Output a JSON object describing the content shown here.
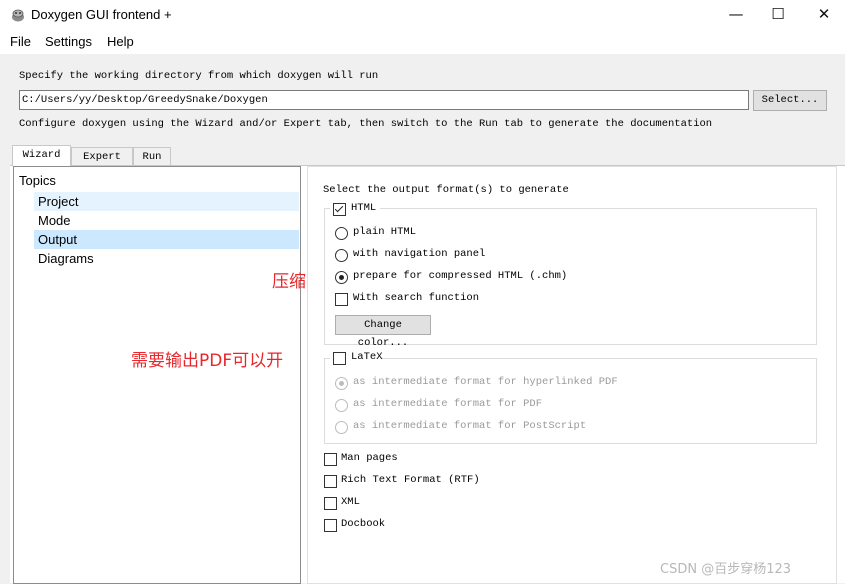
{
  "window": {
    "title": "Doxygen GUI frontend +",
    "minimize_glyph": "—",
    "maximize_glyph": "☐",
    "close_glyph": "✕"
  },
  "menu": [
    "File",
    "Settings",
    "Help"
  ],
  "workdir": {
    "label": "Specify the working directory from which doxygen will run",
    "path": "C:/Users/yy/Desktop/GreedySnake/Doxygen",
    "select_button": "Select..."
  },
  "instructions": "Configure doxygen using the Wizard and/or Expert tab, then switch to the Run tab to generate the documentation",
  "tabs": [
    "Wizard",
    "Expert",
    "Run"
  ],
  "active_tab": "Wizard",
  "topics": {
    "title": "Topics",
    "items": [
      "Project",
      "Mode",
      "Output",
      "Diagrams"
    ],
    "selected": "Output",
    "hovered": "Project"
  },
  "output": {
    "heading": "Select the output format(s) to generate",
    "html": {
      "label": "HTML",
      "checked": true,
      "options": [
        "plain HTML",
        "with navigation panel",
        "prepare for compressed HTML (.chm)"
      ],
      "selected_option": "prepare for compressed HTML (.chm)",
      "search_label": "With search function",
      "search_checked": false,
      "color_button": "Change color..."
    },
    "latex": {
      "label": "LaTeX",
      "checked": false,
      "options": [
        "as intermediate format for hyperlinked PDF",
        "as intermediate format for PDF",
        "as intermediate format for PostScript"
      ],
      "selected_option": "as intermediate format for hyperlinked PDF"
    },
    "others": [
      {
        "label": "Man pages",
        "checked": false
      },
      {
        "label": "Rich Text Format (RTF)",
        "checked": false
      },
      {
        "label": "XML",
        "checked": false
      },
      {
        "label": "Docbook",
        "checked": false
      }
    ]
  },
  "annotations": {
    "compress": "压缩",
    "pdf": "需要输出PDF可以开"
  },
  "watermark": "CSDN @百步穿杨123",
  "colors": {
    "annotation": "#e8262b",
    "selection": "#cce8ff",
    "hover": "#e5f3ff"
  }
}
